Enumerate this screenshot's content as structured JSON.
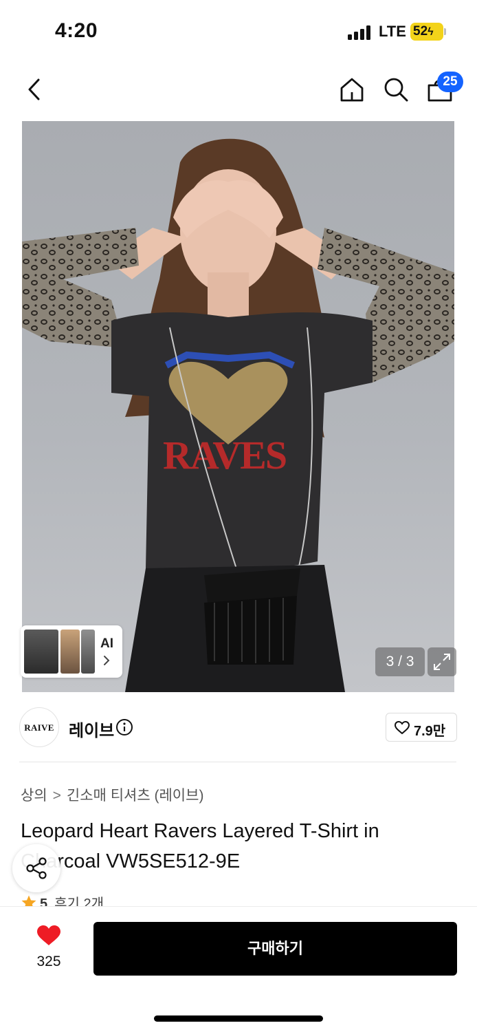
{
  "status_bar": {
    "time": "4:20",
    "network": "LTE",
    "battery": "52"
  },
  "nav": {
    "cart_count": "25",
    "icons": [
      "back-icon",
      "home-icon",
      "search-icon",
      "shopping-bag-icon"
    ]
  },
  "gallery": {
    "ai_label": "AI",
    "page_counter": "3 / 3"
  },
  "brand": {
    "logo_text": "RAIVE",
    "name": "레이브",
    "likes": "7.9만"
  },
  "breadcrumb": {
    "category": "상의",
    "subcategory": "긴소매 티셔츠 (레이브)"
  },
  "product": {
    "title": "Leopard Heart Ravers Layered T-Shirt in Charcoal VW5SE512-9E",
    "rating": "5",
    "reviews": "후기 2개"
  },
  "bottom_bar": {
    "wish_count": "325",
    "buy_label": "구매하기"
  },
  "colors": {
    "accent": "#1463ff",
    "heart": "#ee1c25",
    "star": "#f6a623",
    "buy_button": "#000000",
    "battery": "#f3d31a"
  }
}
